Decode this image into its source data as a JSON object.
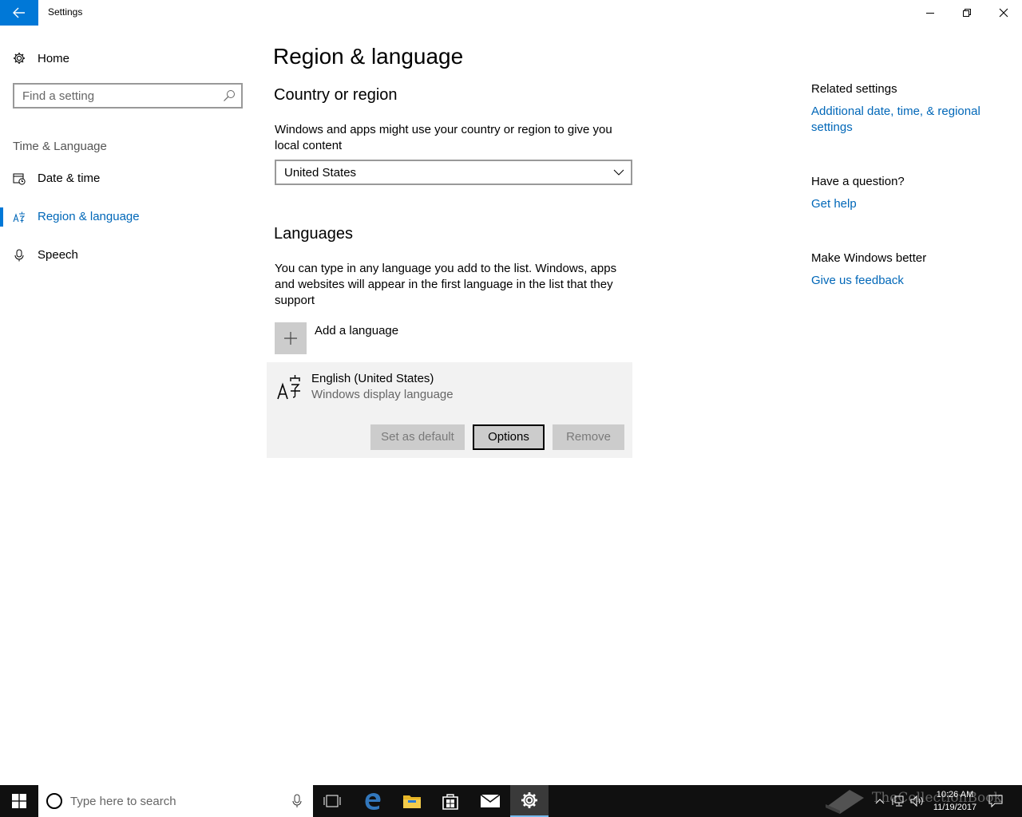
{
  "window": {
    "title": "Settings"
  },
  "sidebar": {
    "home_label": "Home",
    "search_placeholder": "Find a setting",
    "section_label": "Time & Language",
    "items": [
      {
        "label": "Date & time",
        "icon": "date-time-icon"
      },
      {
        "label": "Region & language",
        "icon": "region-language-icon",
        "active": true
      },
      {
        "label": "Speech",
        "icon": "microphone-icon"
      }
    ]
  },
  "main": {
    "title": "Region & language",
    "country": {
      "heading": "Country or region",
      "description": "Windows and apps might use your country or region to give you local content",
      "selected": "United States"
    },
    "languages": {
      "heading": "Languages",
      "description": "You can type in any language you add to the list. Windows, apps and websites will appear in the first language in the list that they support",
      "add_label": "Add a language",
      "items": [
        {
          "name": "English (United States)",
          "subtitle": "Windows display language"
        }
      ],
      "buttons": {
        "set_default": "Set as default",
        "options": "Options",
        "remove": "Remove"
      }
    }
  },
  "related": {
    "heading": "Related settings",
    "link": "Additional date, time, & regional settings",
    "question_heading": "Have a question?",
    "help_link": "Get help",
    "better_heading": "Make Windows better",
    "feedback_link": "Give us feedback"
  },
  "taskbar": {
    "search_placeholder": "Type here to search",
    "time": "10:26 AM",
    "date": "11/19/2017",
    "watermark": "TheCollectionBook"
  },
  "colors": {
    "accent": "#0078d7",
    "link": "#0067b8",
    "taskbar": "#101010"
  }
}
